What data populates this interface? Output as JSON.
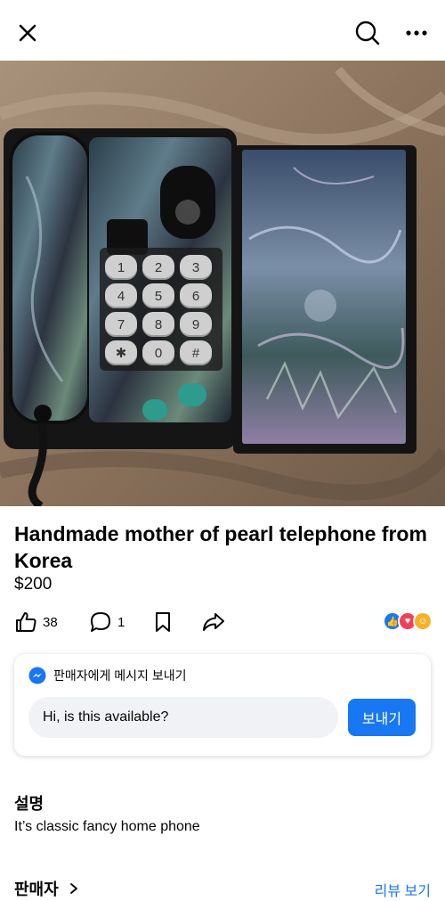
{
  "topbar": {
    "close_icon": "close-icon",
    "search_icon": "search-icon",
    "more_icon": "more-icon"
  },
  "photo": {
    "pager": {
      "count": 4,
      "active": 0
    },
    "keypad": [
      "1",
      "2",
      "3",
      "4",
      "5",
      "6",
      "7",
      "8",
      "9",
      "✱",
      "0",
      "#"
    ]
  },
  "listing": {
    "title": "Handmade mother of pearl telephone from Korea",
    "price": "$200"
  },
  "actions": {
    "like_count": "38",
    "comment_count": "1",
    "reaction_colors": {
      "like": "#1877f2",
      "love": "#f33e58",
      "care": "#f7b125"
    }
  },
  "message": {
    "label": "판매자에게 메시지 보내기",
    "input_value": "Hi, is this available?",
    "send_label": "보내기"
  },
  "description": {
    "heading": "설명",
    "text": "It’s classic fancy home phone"
  },
  "seller": {
    "label": "판매자",
    "review_link": "리뷰 보기"
  },
  "colors": {
    "accent": "#1877f2",
    "input_bg": "#f0f2f5"
  }
}
